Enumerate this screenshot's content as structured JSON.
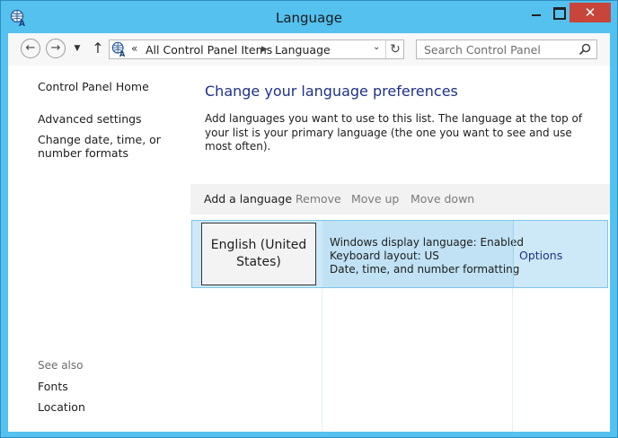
{
  "window": {
    "title": "Language",
    "close_glyph": "✕",
    "icon": "language-globe-icon"
  },
  "nav": {
    "back_glyph": "←",
    "forward_glyph": "→",
    "history_glyph": "▼",
    "up_glyph": "↑",
    "address_chevrons": "«",
    "breadcrumbs": [
      "All Control Panel Items",
      "Language"
    ],
    "breadcrumb_separator": "▶",
    "dropdown_glyph": "⌄",
    "refresh_glyph": "↻",
    "search_placeholder": "Search Control Panel"
  },
  "left_pane": {
    "home": "Control Panel Home",
    "links": [
      "Advanced settings",
      "Change date, time, or number formats"
    ],
    "see_also_label": "See also",
    "see_also": [
      "Fonts",
      "Location"
    ]
  },
  "main": {
    "heading": "Change your language preferences",
    "description": "Add languages you want to use to this list. The language at the top of your list is your primary language (the one you want to see and use most often).",
    "toolbar": {
      "add": "Add a language",
      "remove": "Remove",
      "move_up": "Move up",
      "move_down": "Move down"
    },
    "languages": [
      {
        "name": "English (United States)",
        "info": [
          "Windows display language: Enabled",
          "Keyboard layout: US",
          "Date, time, and number formatting"
        ],
        "options": "Options"
      }
    ]
  },
  "colors": {
    "window_frame": "#54c1ef",
    "close_button": "#c7453a",
    "heading": "#1e3287",
    "selected_row": "#cde8f6"
  }
}
